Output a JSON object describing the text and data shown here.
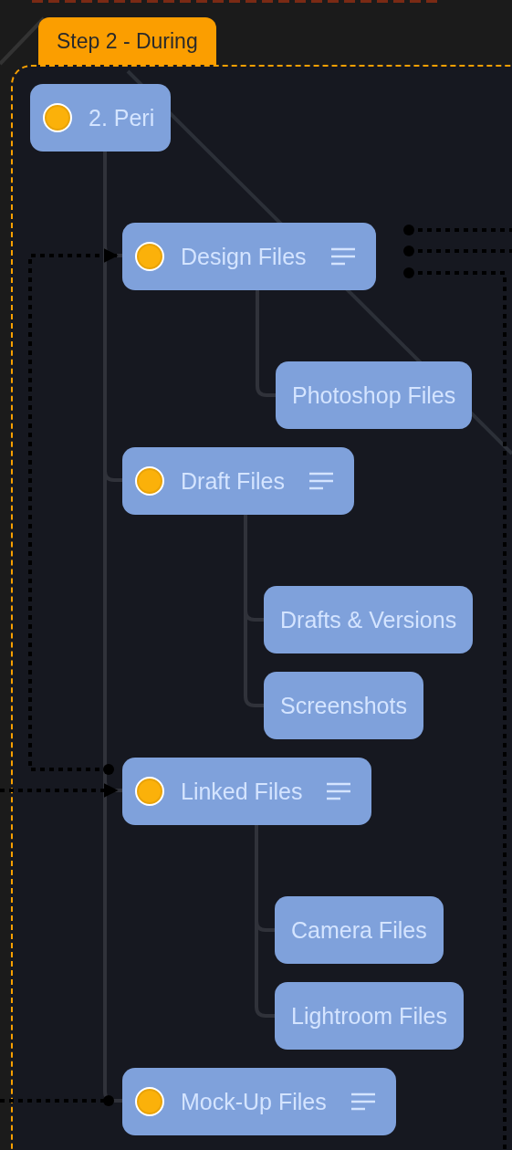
{
  "group": {
    "label": "Step 2 - During"
  },
  "root": {
    "label": "2. Peri",
    "status": true,
    "notes": false,
    "children": [
      {
        "label": "Design Files",
        "status": true,
        "notes": true,
        "children": [
          {
            "label": "Photoshop Files",
            "status": false,
            "notes": false
          }
        ]
      },
      {
        "label": "Draft Files",
        "status": true,
        "notes": true,
        "children": [
          {
            "label": "Drafts & Versions",
            "status": false,
            "notes": false
          },
          {
            "label": "Screenshots",
            "status": false,
            "notes": false
          }
        ]
      },
      {
        "label": "Linked Files",
        "status": true,
        "notes": true,
        "children": [
          {
            "label": "Camera Files",
            "status": false,
            "notes": false
          },
          {
            "label": "Lightroom Files",
            "status": false,
            "notes": false
          }
        ]
      },
      {
        "label": "Mock-Up Files",
        "status": true,
        "notes": true
      }
    ]
  }
}
